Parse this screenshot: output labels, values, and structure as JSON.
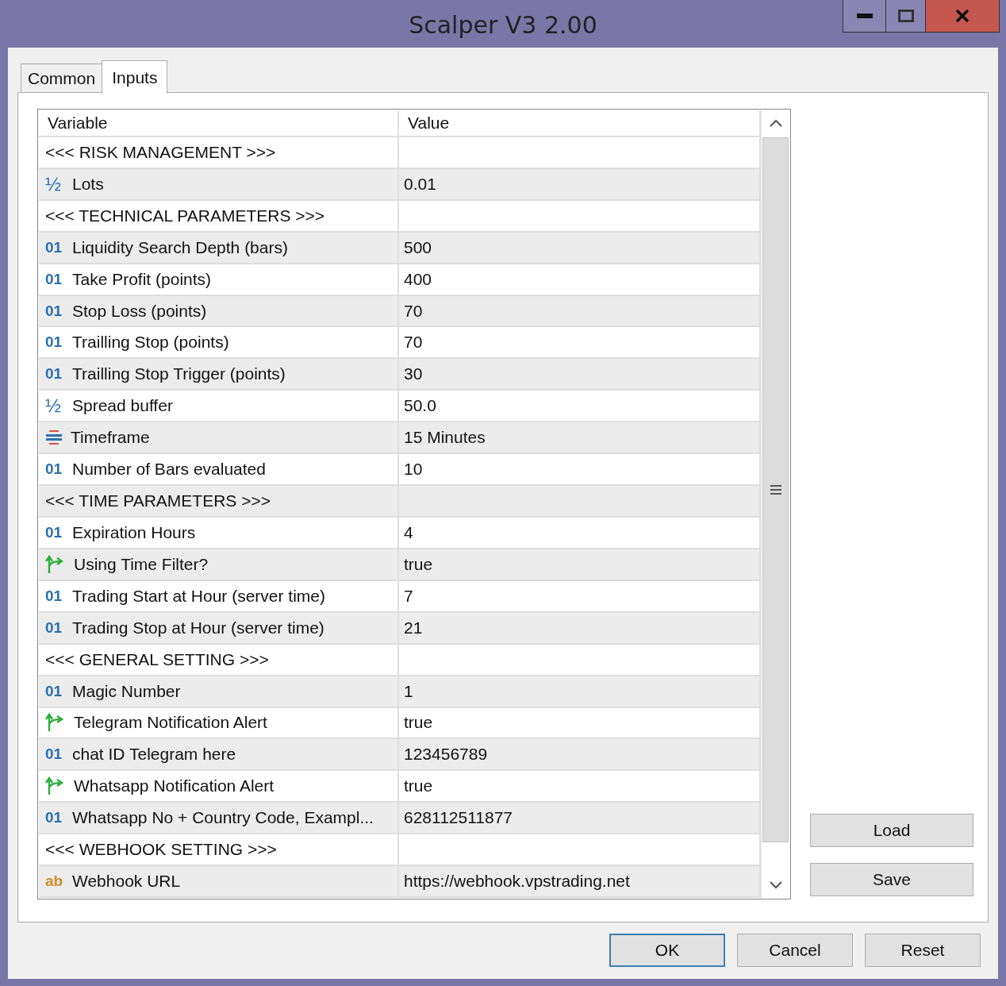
{
  "window": {
    "title": "Scalper V3 2.00"
  },
  "tabs": [
    {
      "label": "Common",
      "selected": false
    },
    {
      "label": "Inputs",
      "selected": true
    }
  ],
  "table": {
    "columns": [
      "Variable",
      "Value"
    ],
    "rows": [
      {
        "kind": "section",
        "variable": "<<< RISK MANAGEMENT >>>",
        "value": ""
      },
      {
        "kind": "double",
        "icon_text": "½",
        "variable": "Lots",
        "value": "0.01"
      },
      {
        "kind": "section",
        "variable": "<<< TECHNICAL PARAMETERS >>>",
        "value": ""
      },
      {
        "kind": "int",
        "icon_text": "01",
        "variable": "Liquidity Search Depth (bars)",
        "value": "500"
      },
      {
        "kind": "int",
        "icon_text": "01",
        "variable": "Take Profit (points)",
        "value": "400"
      },
      {
        "kind": "int",
        "icon_text": "01",
        "variable": "Stop Loss (points)",
        "value": "70"
      },
      {
        "kind": "int",
        "icon_text": "01",
        "variable": "Trailling Stop (points)",
        "value": "70"
      },
      {
        "kind": "int",
        "icon_text": "01",
        "variable": "Trailling Stop Trigger (points)",
        "value": "30"
      },
      {
        "kind": "double",
        "icon_text": "½",
        "variable": "Spread buffer",
        "value": "50.0"
      },
      {
        "kind": "enum",
        "variable": "Timeframe",
        "value": "15 Minutes"
      },
      {
        "kind": "int",
        "icon_text": "01",
        "variable": "Number of Bars evaluated",
        "value": "10"
      },
      {
        "kind": "section",
        "variable": "<<< TIME PARAMETERS >>>",
        "value": ""
      },
      {
        "kind": "int",
        "icon_text": "01",
        "variable": "Expiration Hours",
        "value": "4"
      },
      {
        "kind": "bool",
        "variable": "Using Time Filter?",
        "value": "true"
      },
      {
        "kind": "int",
        "icon_text": "01",
        "variable": "Trading Start at Hour (server time)",
        "value": "7"
      },
      {
        "kind": "int",
        "icon_text": "01",
        "variable": "Trading Stop at Hour (server time)",
        "value": "21"
      },
      {
        "kind": "section",
        "variable": "<<< GENERAL SETTING >>>",
        "value": ""
      },
      {
        "kind": "int",
        "icon_text": "01",
        "variable": "Magic Number",
        "value": "1"
      },
      {
        "kind": "bool",
        "variable": "Telegram Notification Alert",
        "value": "true"
      },
      {
        "kind": "int",
        "icon_text": "01",
        "variable": "chat ID Telegram here",
        "value": "123456789"
      },
      {
        "kind": "bool",
        "variable": "Whatsapp Notification Alert",
        "value": "true"
      },
      {
        "kind": "int",
        "icon_text": "01",
        "variable": "Whatsapp No + Country Code, Exampl...",
        "value": "628112511877"
      },
      {
        "kind": "section",
        "variable": "<<< WEBHOOK SETTING >>>",
        "value": ""
      },
      {
        "kind": "string",
        "icon_text": "ab",
        "variable": "Webhook URL",
        "value": "https://webhook.vpstrading.net"
      }
    ]
  },
  "side_buttons": [
    "Load",
    "Save"
  ],
  "buttons": [
    "OK",
    "Cancel",
    "Reset"
  ]
}
